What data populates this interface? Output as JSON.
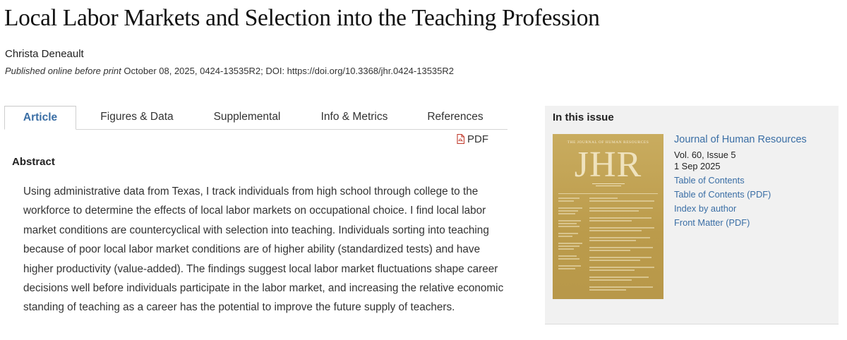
{
  "article": {
    "title": "Local Labor Markets and Selection into the Teaching Profession",
    "author": "Christa Deneault",
    "published_label": "Published online before print",
    "published_details": "October 08, 2025, 0424-13535R2; DOI: https://doi.org/10.3368/jhr.0424-13535R2"
  },
  "tabs": [
    {
      "label": "Article",
      "active": true
    },
    {
      "label": "Figures & Data",
      "active": false
    },
    {
      "label": "Supplemental",
      "active": false
    },
    {
      "label": "Info & Metrics",
      "active": false
    },
    {
      "label": "References",
      "active": false
    }
  ],
  "pdf_label": "PDF",
  "abstract": {
    "heading": "Abstract",
    "text": "Using administrative data from Texas, I track individuals from high school through college to the workforce to determine the effects of local labor markets on occupational choice. I find local labor market conditions are countercyclical with selection into teaching. Individuals sorting into teaching because of poor local labor market conditions are of higher ability (standardized tests) and have higher productivity (value-added). The findings suggest local labor market fluctuations shape career decisions well before individuals participate in the labor market, and increasing the relative economic standing of teaching as a career has the potential to improve the future supply of teachers."
  },
  "sidebar": {
    "heading": "In this issue",
    "journal": "Journal of Human Resources",
    "volume_issue": "Vol. 60, Issue 5",
    "date": "1 Sep 2025",
    "links": [
      "Table of Contents",
      "Table of Contents (PDF)",
      "Index by author",
      "Front Matter (PDF)"
    ],
    "cover": {
      "header": "THE JOURNAL OF HUMAN RESOURCES",
      "logo": "JHR"
    }
  },
  "colors": {
    "link": "#3a6ea5",
    "sidebar_bg": "#f1f1f1",
    "cover_gold": "#c2a455",
    "pdf_icon": "#c0392b"
  },
  "icons": {
    "pdf": "pdf-file-icon"
  }
}
